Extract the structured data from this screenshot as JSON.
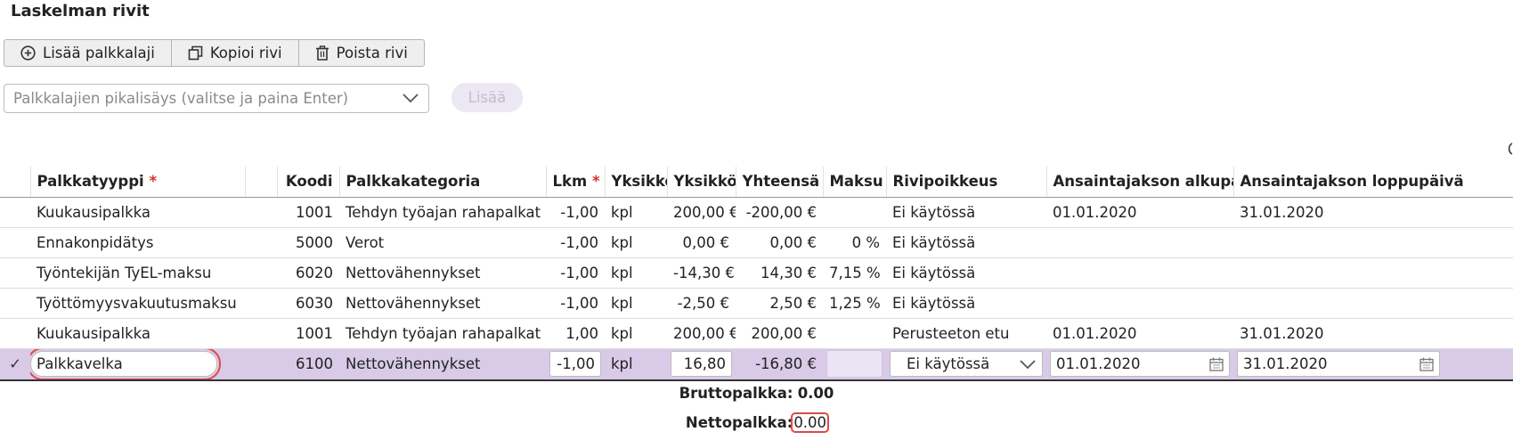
{
  "page": {
    "title": "Laskelman rivit"
  },
  "toolbar": {
    "add_label": "Lisää palkkalaji",
    "copy_label": "Kopioi rivi",
    "delete_label": "Poista rivi"
  },
  "quickadd": {
    "placeholder": "Palkkalajien pikalisäys (valitse ja paina Enter)",
    "add_label": "Lisää"
  },
  "table": {
    "headers": {
      "palkkatyyppi": "Palkkatyyppi",
      "required_mark": "*",
      "koodi": "Koodi",
      "palkkakategoria": "Palkkakategoria",
      "lkm": "Lkm",
      "yksikko": "Yksikkö",
      "yksikkohinta": "Yksikköh",
      "yhteensa": "Yhteensä",
      "maksu": "Maksu",
      "rivipoikkeus": "Rivipoikkeus",
      "alkupaiva": "Ansaintajakson alkupäivä",
      "loppupaiva": "Ansaintajakson loppupäivä"
    },
    "rows": [
      {
        "tyyppi": "Kuukausipalkka",
        "koodi": "1001",
        "kategoria": "Tehdyn työajan rahapalkat",
        "lkm": "-1,00",
        "yksikko": "kpl",
        "hinta": "200,00 €",
        "yhteensa": "-200,00 €",
        "maksu": "",
        "poikkeus": "Ei käytössä",
        "alku": "01.01.2020",
        "loppu": "31.01.2020"
      },
      {
        "tyyppi": "Ennakonpidätys",
        "koodi": "5000",
        "kategoria": "Verot",
        "lkm": "-1,00",
        "yksikko": "kpl",
        "hinta": "0,00 €",
        "yhteensa": "0,00 €",
        "maksu": "0 %",
        "poikkeus": "Ei käytössä",
        "alku": "",
        "loppu": ""
      },
      {
        "tyyppi": "Työntekijän TyEL-maksu",
        "koodi": "6020",
        "kategoria": "Nettovähennykset",
        "lkm": "-1,00",
        "yksikko": "kpl",
        "hinta": "-14,30 €",
        "yhteensa": "14,30 €",
        "maksu": "7,15 %",
        "poikkeus": "Ei käytössä",
        "alku": "",
        "loppu": ""
      },
      {
        "tyyppi": "Työttömyysvakuutusmaksu",
        "koodi": "6030",
        "kategoria": "Nettovähennykset",
        "lkm": "-1,00",
        "yksikko": "kpl",
        "hinta": "-2,50 €",
        "yhteensa": "2,50 €",
        "maksu": "1,25 %",
        "poikkeus": "Ei käytössä",
        "alku": "",
        "loppu": ""
      },
      {
        "tyyppi": "Kuukausipalkka",
        "koodi": "1001",
        "kategoria": "Tehdyn työajan rahapalkat",
        "lkm": "1,00",
        "yksikko": "kpl",
        "hinta": "200,00 €",
        "yhteensa": "200,00 €",
        "maksu": "",
        "poikkeus": "Perusteeton etu",
        "alku": "01.01.2020",
        "loppu": "31.01.2020"
      }
    ],
    "edit_row": {
      "check": "✓",
      "tyyppi": "Palkkavelka",
      "koodi": "6100",
      "kategoria": "Nettovähennykset",
      "lkm": "-1,00",
      "yksikko": "kpl",
      "hinta": "16,80",
      "yhteensa": "-16,80 €",
      "maksu": "",
      "poikkeus": "Ei käytössä",
      "alku": "01.01.2020",
      "loppu": "31.01.2020"
    }
  },
  "totals": {
    "brutto_label": "Bruttopalkka:",
    "brutto_value": "0.00",
    "netto_label": "Nettopalkka:",
    "netto_value": "0.00"
  },
  "colors": {
    "accent_purple": "#d9cbe8",
    "required_red": "#d9302b",
    "highlight_red": "#e04848"
  }
}
